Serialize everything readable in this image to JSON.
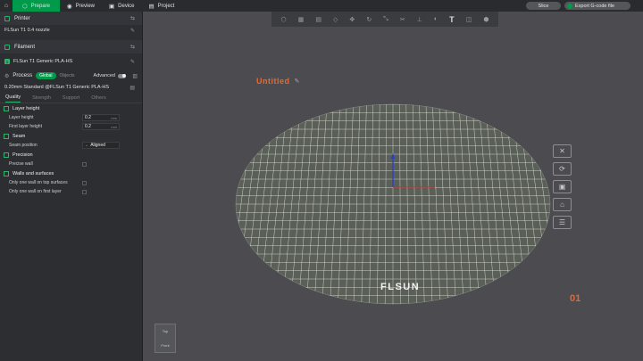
{
  "topbar": {
    "tabs": [
      {
        "label": "Prepare",
        "icon": "cube-icon",
        "active": true
      },
      {
        "label": "Preview",
        "icon": "eye-icon",
        "active": false
      },
      {
        "label": "Device",
        "icon": "device-icon",
        "active": false
      },
      {
        "label": "Project",
        "icon": "project-icon",
        "active": false
      }
    ],
    "slice_label": "Slice",
    "export_label": "Export G-code file"
  },
  "panel": {
    "printer": {
      "title": "Printer",
      "value": "FLSun T1 0.4 nozzle"
    },
    "filament": {
      "title": "Filament",
      "slot": "1",
      "value": "FLSun T1 Generic PLA-HS"
    },
    "process": {
      "title": "Process",
      "global_label": "Global",
      "objects_label": "Objects",
      "advanced_label": "Advanced",
      "preset": "0.20mm Standard @FLSun T1 Generic PLA-HS"
    },
    "tabs": [
      "Quality",
      "Strength",
      "Support",
      "Others"
    ],
    "groups": {
      "layer_height": {
        "title": "Layer height",
        "params": [
          {
            "label": "Layer height",
            "value": "0.2",
            "unit": "mm"
          },
          {
            "label": "First layer height",
            "value": "0.2",
            "unit": "mm"
          }
        ]
      },
      "seam": {
        "title": "Seam",
        "param_label": "Seam position",
        "param_value": "Aligned"
      },
      "precision": {
        "title": "Precision",
        "param_label": "Precise wall"
      },
      "walls": {
        "title": "Walls and surfaces",
        "params": [
          "Only one wall on top surfaces",
          "Only one wall on first layer"
        ]
      }
    }
  },
  "viewport": {
    "plate_title": "Untitled",
    "plate_number": "01",
    "bed_logo": "FLSUN",
    "cube_top": "Top",
    "cube_front": "Front"
  },
  "colors": {
    "accent": "#009b4a",
    "orange": "#e8692e",
    "bed": "#5a6058"
  }
}
